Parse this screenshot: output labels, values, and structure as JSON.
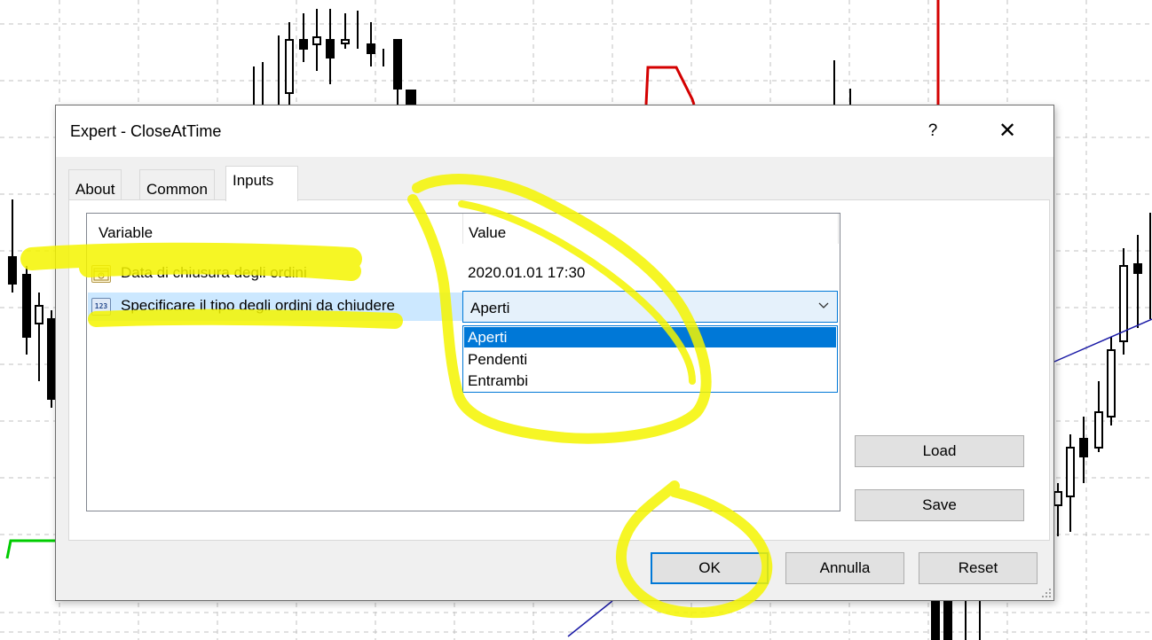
{
  "dialog": {
    "title": "Expert - CloseAtTime",
    "help_label": "?",
    "close_label": "✕"
  },
  "tabs": [
    {
      "label": "About",
      "active": false
    },
    {
      "label": "Common",
      "active": false
    },
    {
      "label": "Inputs",
      "active": true
    }
  ],
  "table": {
    "columns": [
      "Variable",
      "Value"
    ],
    "rows": [
      {
        "icon": "calendar-icon",
        "variable": "Data di chiusura degli ordini",
        "value": "2020.01.01 17:30"
      },
      {
        "icon": "number-123-icon",
        "icon_text": "123",
        "variable": "Specificare il tipo degli ordini da chiudere",
        "value": "Aperti"
      }
    ]
  },
  "dropdown": {
    "selected": "Aperti",
    "options": [
      "Aperti",
      "Pendenti",
      "Entrambi"
    ],
    "highlighted_index": 0
  },
  "side_buttons": {
    "load_label": "Load",
    "save_label": "Save"
  },
  "bottom_buttons": {
    "ok_label": "OK",
    "cancel_label": "Annulla",
    "reset_label": "Reset"
  },
  "colors": {
    "accent": "#0078d7",
    "selection": "#cce8ff",
    "highlighter": "#f5f500",
    "chart_red": "#d40000",
    "chart_green": "#00cc00",
    "chart_blue": "#1a1aa6"
  }
}
